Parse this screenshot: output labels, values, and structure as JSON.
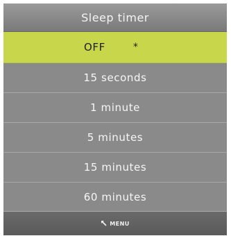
{
  "title": "Sleep timer",
  "items": [
    {
      "label": "OFF",
      "mark": "*",
      "selected": true
    },
    {
      "label": "15 seconds"
    },
    {
      "label": "1 minute"
    },
    {
      "label": "5 minutes"
    },
    {
      "label": "15 minutes"
    },
    {
      "label": "60 minutes"
    }
  ],
  "footer": {
    "label": "MENU",
    "icon": "back-arrow-icon"
  },
  "colors": {
    "highlight": "#c7d64a",
    "item_bg": "#8a8a8a",
    "footer_bg": "#5f5f5f"
  }
}
